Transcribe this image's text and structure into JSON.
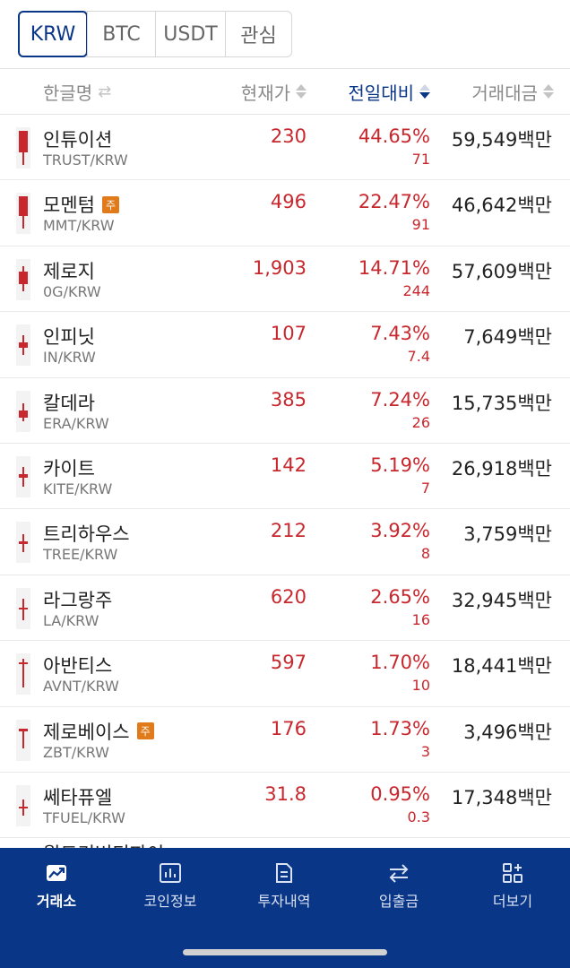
{
  "tabs": [
    {
      "label": "KRW",
      "active": true
    },
    {
      "label": "BTC",
      "active": false
    },
    {
      "label": "USDT",
      "active": false
    },
    {
      "label": "관심",
      "active": false
    }
  ],
  "header": {
    "name": "한글명",
    "price": "현재가",
    "change": "전일대비",
    "volume": "거래대금"
  },
  "colors": {
    "rise": "#c8272d",
    "brand": "#093687",
    "badge": "#e07a1a"
  },
  "rows": [
    {
      "name": "인튜이션",
      "pair": "TRUST/KRW",
      "price": "230",
      "pct": "44.65%",
      "diff": "71",
      "volume": "59,549백만",
      "badge": ""
    },
    {
      "name": "모멘텀",
      "pair": "MMT/KRW",
      "price": "496",
      "pct": "22.47%",
      "diff": "91",
      "volume": "46,642백만",
      "badge": "주"
    },
    {
      "name": "제로지",
      "pair": "0G/KRW",
      "price": "1,903",
      "pct": "14.71%",
      "diff": "244",
      "volume": "57,609백만",
      "badge": ""
    },
    {
      "name": "인피닛",
      "pair": "IN/KRW",
      "price": "107",
      "pct": "7.43%",
      "diff": "7.4",
      "volume": "7,649백만",
      "badge": ""
    },
    {
      "name": "칼데라",
      "pair": "ERA/KRW",
      "price": "385",
      "pct": "7.24%",
      "diff": "26",
      "volume": "15,735백만",
      "badge": ""
    },
    {
      "name": "카이트",
      "pair": "KITE/KRW",
      "price": "142",
      "pct": "5.19%",
      "diff": "7",
      "volume": "26,918백만",
      "badge": ""
    },
    {
      "name": "트리하우스",
      "pair": "TREE/KRW",
      "price": "212",
      "pct": "3.92%",
      "diff": "8",
      "volume": "3,759백만",
      "badge": ""
    },
    {
      "name": "라그랑주",
      "pair": "LA/KRW",
      "price": "620",
      "pct": "2.65%",
      "diff": "16",
      "volume": "32,945백만",
      "badge": ""
    },
    {
      "name": "아반티스",
      "pair": "AVNT/KRW",
      "price": "597",
      "pct": "1.70%",
      "diff": "10",
      "volume": "18,441백만",
      "badge": ""
    },
    {
      "name": "제로베이스",
      "pair": "ZBT/KRW",
      "price": "176",
      "pct": "1.73%",
      "diff": "3",
      "volume": "3,496백만",
      "badge": "주"
    },
    {
      "name": "쎄타퓨엘",
      "pair": "TFUEL/KRW",
      "price": "31.8",
      "pct": "0.95%",
      "diff": "0.3",
      "volume": "17,348백만",
      "badge": ""
    }
  ],
  "partial_row": {
    "name": "월드리버티파이"
  },
  "bottom_nav": [
    {
      "label": "거래소",
      "icon": "chart-up-icon",
      "active": true
    },
    {
      "label": "코인정보",
      "icon": "bar-chart-icon",
      "active": false
    },
    {
      "label": "투자내역",
      "icon": "document-icon",
      "active": false
    },
    {
      "label": "입출금",
      "icon": "transfer-icon",
      "active": false
    },
    {
      "label": "더보기",
      "icon": "grid-plus-icon",
      "active": false
    }
  ]
}
